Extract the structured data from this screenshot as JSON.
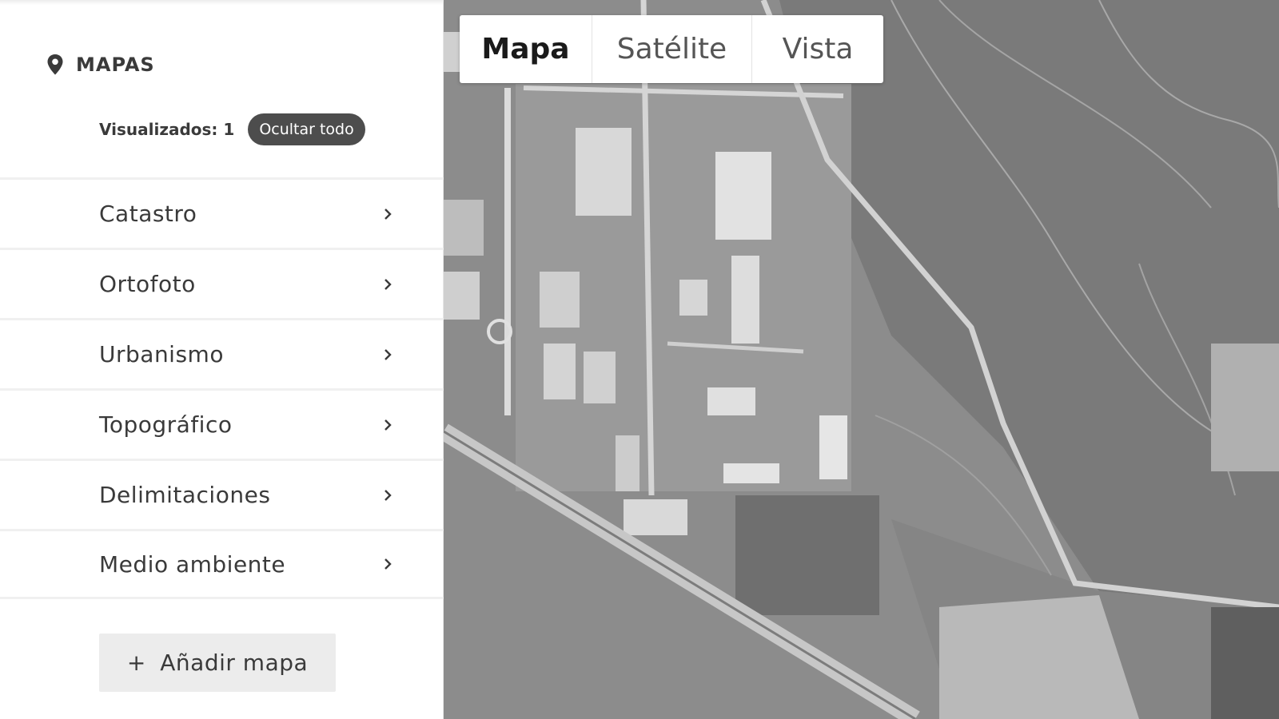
{
  "sidebar": {
    "section_title": "MAPAS",
    "section_icon": "map-pin-icon",
    "visible_label": "Visualizados: 1",
    "hide_all_label": "Ocultar todo",
    "items": [
      {
        "label": "Catastro"
      },
      {
        "label": "Ortofoto"
      },
      {
        "label": "Urbanismo"
      },
      {
        "label": "Topográfico"
      },
      {
        "label": "Delimitaciones"
      },
      {
        "label": "Medio ambiente"
      }
    ],
    "add_plus": "+",
    "add_label": "Añadir mapa"
  },
  "map_view": {
    "options": [
      "Mapa",
      "Satélite",
      "Vista"
    ],
    "selected": "Mapa",
    "imagery": "grayscale-aerial-orthophoto"
  },
  "colors": {
    "text": "#3a3a3a",
    "badge_bg": "#4d4d4d",
    "divider": "#f0f0f0",
    "add_button_bg": "#ececec"
  }
}
